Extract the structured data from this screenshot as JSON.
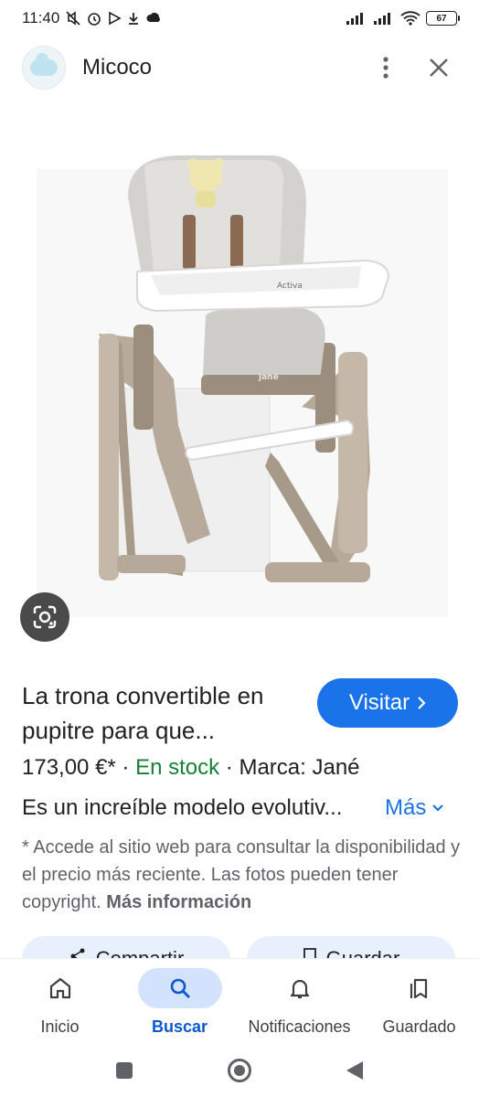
{
  "status_bar": {
    "time": "11:40",
    "battery": "67"
  },
  "header": {
    "site_name": "Micoco"
  },
  "product_image": {
    "brand_text": "Activa",
    "model_text": "jané"
  },
  "product": {
    "title": "La trona convertible en pupitre para que...",
    "visit_label": "Visitar",
    "price": "173,00 €*",
    "separator": " · ",
    "stock": "En stock",
    "brand": "Marca: Jané",
    "description": "Es un increíble modelo evolutiv...",
    "more_label": "Más",
    "disclaimer": "* Accede al sitio web para consultar la disponibilidad y el precio más reciente. Las fotos pueden tener copyright.",
    "more_info_label": "Más información"
  },
  "actions": {
    "share_label": "Compartir",
    "save_label": "Guardar"
  },
  "bottom_nav": {
    "items": [
      {
        "label": "Inicio",
        "icon": "home-icon"
      },
      {
        "label": "Buscar",
        "icon": "search-icon"
      },
      {
        "label": "Notificaciones",
        "icon": "bell-icon"
      },
      {
        "label": "Guardado",
        "icon": "bookmarks-icon"
      }
    ],
    "active": "Buscar"
  },
  "colors": {
    "accent": "#1a73e8",
    "stock_green": "#188038",
    "active_nav_bg": "#d3e3fd"
  }
}
